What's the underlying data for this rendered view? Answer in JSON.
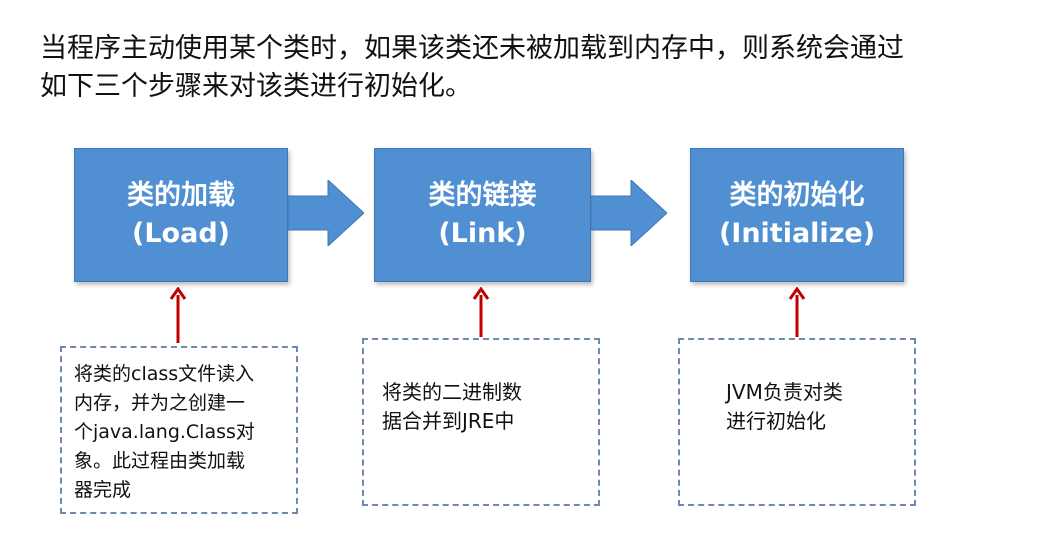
{
  "intro": {
    "line1": "当程序主动使用某个类时，如果该类还未被加载到内存中，则系统会通过",
    "line2": "如下三个步骤来对该类进行初始化。"
  },
  "stages": [
    {
      "title": "类的加载",
      "subtitle": "(Load)"
    },
    {
      "title": "类的链接",
      "subtitle": "(Link)"
    },
    {
      "title": "类的初始化",
      "subtitle": "(Initialize)"
    }
  ],
  "notes": [
    {
      "lines": [
        "将类的class文件读入",
        "内存，并为之创建一",
        "个java.lang.Class对",
        "象。此过程由类加载",
        "器完成"
      ]
    },
    {
      "lines": [
        "将类的二进制数",
        "据合并到JRE中"
      ]
    },
    {
      "lines": [
        "JVM负责对类",
        "进行初始化"
      ]
    }
  ],
  "colors": {
    "stage_fill": "#4f8fd2",
    "pointer": "#c00000",
    "note_border": "#6e8aa8"
  }
}
